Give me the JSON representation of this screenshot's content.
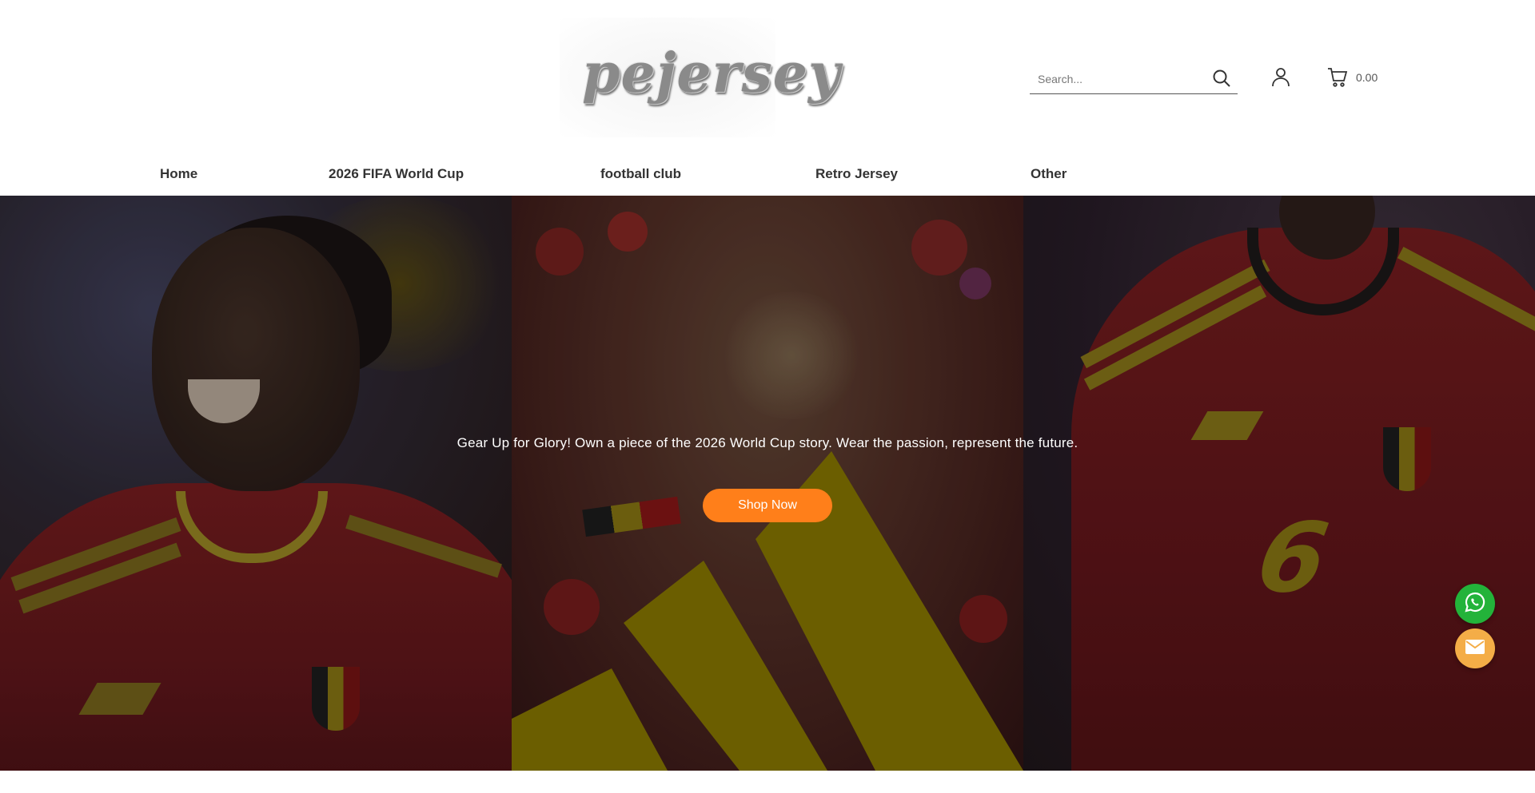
{
  "header": {
    "logo_text": "pejersey",
    "search": {
      "placeholder": "Search...",
      "value": ""
    },
    "cart": {
      "total": "0.00"
    }
  },
  "nav": {
    "items": [
      {
        "label": "Home"
      },
      {
        "label": "2026 FIFA World Cup"
      },
      {
        "label": "football club"
      },
      {
        "label": "Retro Jersey"
      },
      {
        "label": "Other"
      }
    ]
  },
  "hero": {
    "caption": "Gear Up for Glory! Own a piece of the 2026 World Cup story. Wear the passion, represent the future.",
    "button_label": "Shop Now",
    "right_player_number": "6"
  },
  "floating": {
    "whatsapp_icon": "whatsapp-icon",
    "email_icon": "email-icon"
  },
  "colors": {
    "accent": "#ff7f1a",
    "whatsapp": "#23b33a",
    "email": "#f4ad47",
    "stripe": "#7a6b00"
  }
}
